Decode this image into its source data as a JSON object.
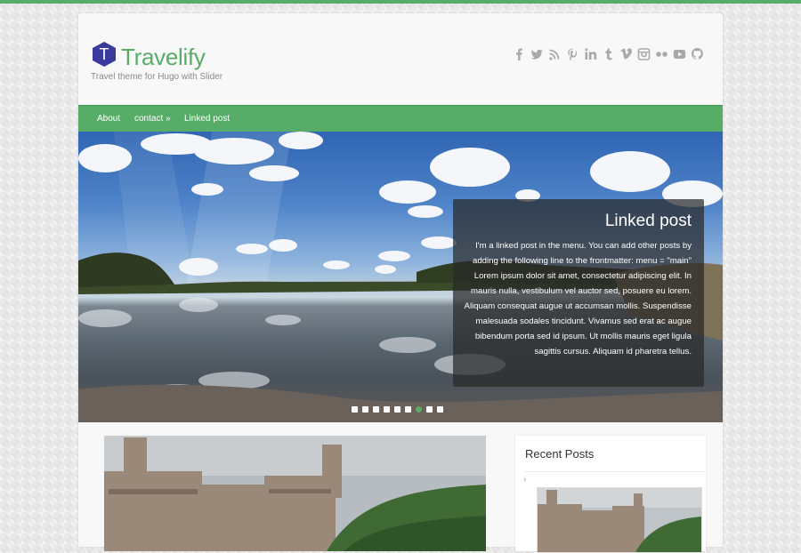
{
  "site": {
    "logo_letter": "T",
    "title": "Travelify",
    "tagline": "Travel theme for Hugo with Slider"
  },
  "social_icons": [
    "facebook-icon",
    "twitter-icon",
    "rss-icon",
    "pinterest-icon",
    "linkedin-icon",
    "tumblr-icon",
    "vimeo-icon",
    "instagram-icon",
    "flickr-icon",
    "youtube-icon",
    "github-icon"
  ],
  "nav": {
    "items": [
      {
        "label": "About"
      },
      {
        "label": "contact »"
      },
      {
        "label": "Linked post"
      }
    ]
  },
  "slider": {
    "caption_title": "Linked post",
    "caption_text": "I'm a linked post in the menu. You can add other posts by adding the following line to the frontmatter: menu = \"main\" Lorem ipsum dolor sit amet, consectetur adipiscing elit. In mauris nulla, vestibulum vel auctor sed, posuere eu lorem. Aliquam consequat augue ut accumsan mollis. Suspendisse malesuada sodales tincidunt. Vivamus sed erat ac augue bibendum porta sed id ipsum. Ut mollis mauris eget ligula sagittis cursus. Aliquam id pharetra tellus.",
    "slide_count": 9,
    "active_slide": 7
  },
  "sidebar": {
    "widget_title": "Recent Posts",
    "bullet": "›"
  },
  "colors": {
    "accent": "#57ad68",
    "caption_bg": "#282828"
  }
}
